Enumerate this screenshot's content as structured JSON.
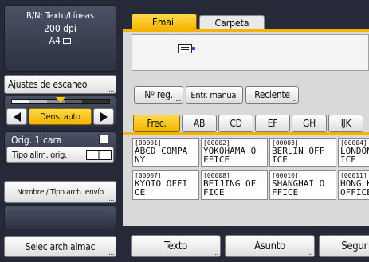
{
  "left": {
    "scan_info": {
      "line1": "B/N: Texto/Líneas",
      "line2": "200 dpi",
      "line3": "A4"
    },
    "scan_settings_label": "Ajustes de escaneo",
    "density_label": "Dens. auto",
    "orig_label": "Orig. 1 cara",
    "feed_type_label": "Tipo alim. orig.",
    "name_type_label": "Nombre / Tipo arch. envío",
    "select_file_label": "Selec arch almac"
  },
  "tabs": {
    "email": "Email",
    "folder": "Carpeta"
  },
  "dest_buttons": {
    "reg_no": "Nº reg.",
    "manual": "Entr. manual",
    "recent": "Reciente"
  },
  "index_tabs": [
    "Frec.",
    "AB",
    "CD",
    "EF",
    "GH",
    "IJK"
  ],
  "destinations": [
    {
      "num": "[00001]",
      "line1": "ABCD COMPA",
      "line2": "NY"
    },
    {
      "num": "[00002]",
      "line1": "YOKOHAMA O",
      "line2": "FFICE"
    },
    {
      "num": "[00003]",
      "line1": "BERLIN OFF",
      "line2": "ICE"
    },
    {
      "num": "[00004]",
      "line1": "LONDON",
      "line2": "ICE"
    },
    {
      "num": "[00007]",
      "line1": "KYOTO OFFI",
      "line2": "CE"
    },
    {
      "num": "[00008]",
      "line1": "BEIJING OF",
      "line2": "FICE"
    },
    {
      "num": "[00010]",
      "line1": "SHANGHAI O",
      "line2": "FFICE"
    },
    {
      "num": "[00011]",
      "line1": "HONG K",
      "line2": "OFFICE"
    }
  ],
  "bottom": {
    "text": "Texto",
    "subject": "Asunto",
    "security": "Segur"
  }
}
